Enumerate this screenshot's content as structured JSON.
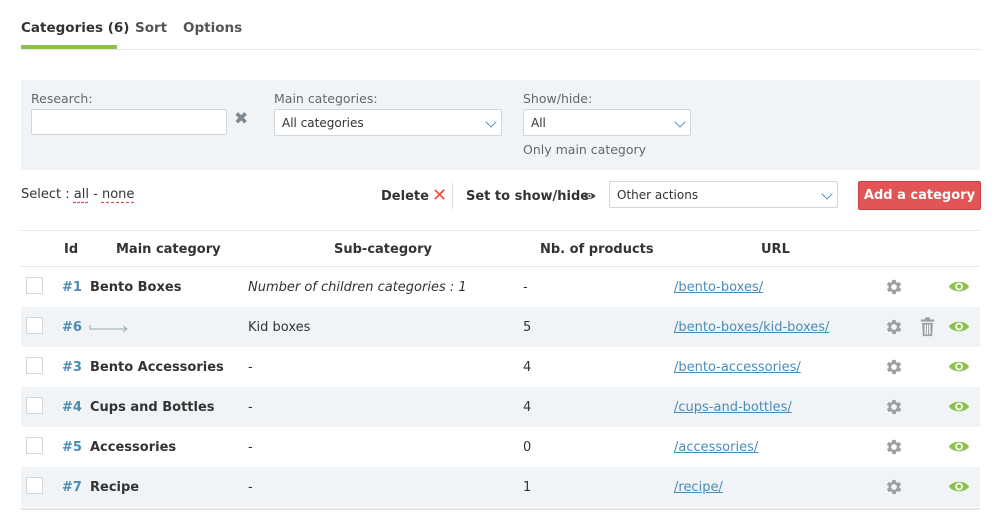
{
  "tabs": [
    {
      "label": "Categories (6)",
      "active": true
    },
    {
      "label": "Sort",
      "active": false
    },
    {
      "label": "Options",
      "active": false
    }
  ],
  "filters": {
    "research_label": "Research:",
    "research_value": "",
    "main_categories_label": "Main categories:",
    "main_categories_value": "All categories",
    "show_hide_label": "Show/hide:",
    "show_hide_value": "All",
    "only_main_text": "Only main category"
  },
  "actions": {
    "select_label": "Select :",
    "select_all": "all",
    "select_sep": "-",
    "select_none": "none",
    "delete_label": "Delete",
    "show_hide_label": "Set to show/hide",
    "other_actions": "Other actions",
    "add_category": "Add a category"
  },
  "table": {
    "headers": {
      "id": "Id",
      "main": "Main category",
      "sub": "Sub-category",
      "nb": "Nb. of products",
      "url": "URL"
    },
    "rows": [
      {
        "id": "#1",
        "main": "Bento Boxes",
        "sub": "Number of children categories : 1",
        "nb": "-",
        "url": "/bento-boxes/",
        "is_child": false,
        "delete": false
      },
      {
        "id": "#6",
        "main": "",
        "sub": "Kid boxes",
        "nb": "5",
        "url": "/bento-boxes/kid-boxes/",
        "is_child": true,
        "delete": true
      },
      {
        "id": "#3",
        "main": "Bento Accessories",
        "sub": "-",
        "nb": "4",
        "url": "/bento-accessories/",
        "is_child": false,
        "delete": false
      },
      {
        "id": "#4",
        "main": "Cups and Bottles",
        "sub": "-",
        "nb": "4",
        "url": "/cups-and-bottles/",
        "is_child": false,
        "delete": false
      },
      {
        "id": "#5",
        "main": "Accessories",
        "sub": "-",
        "nb": "0",
        "url": "/accessories/",
        "is_child": false,
        "delete": false
      },
      {
        "id": "#7",
        "main": "Recipe",
        "sub": "-",
        "nb": "1",
        "url": "/recipe/",
        "is_child": false,
        "delete": false
      }
    ]
  },
  "icons": {
    "settings": "gear-icon",
    "delete": "trash-icon",
    "visible": "eye-icon",
    "clear": "close-icon",
    "dropdown": "chevron-down-icon"
  },
  "colors": {
    "accent": "#8bc34a",
    "link": "#4a8bb5",
    "danger": "#e35454",
    "eye": "#8bc34a",
    "gear": "#9e9e9e"
  }
}
